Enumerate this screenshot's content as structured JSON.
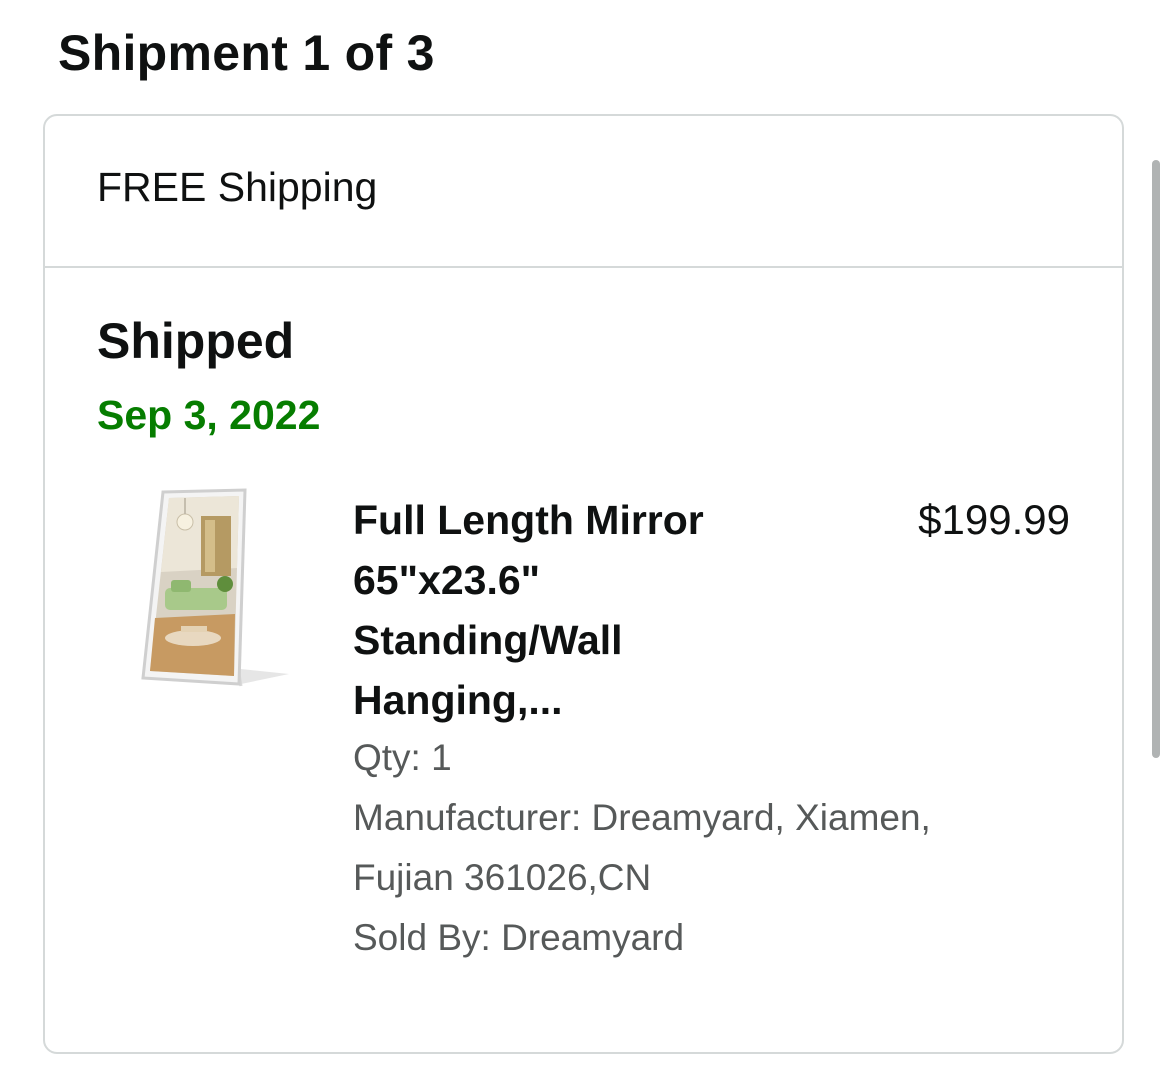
{
  "header": {
    "shipment_title": "Shipment 1 of 3"
  },
  "card": {
    "shipping_label": "FREE Shipping",
    "status": "Shipped",
    "status_date": "Sep 3, 2022",
    "status_date_color": "#067d00"
  },
  "item": {
    "image_icon": "product-mirror-image",
    "title": "Full Length Mirror 65\"x23.6\" Standing/Wall Hanging,...",
    "price": "$199.99",
    "qty": "Qty: 1",
    "manufacturer": "Manufacturer: Dreamyard, Xiamen, Fujian 361026,CN",
    "sold_by": "Sold By: Dreamyard"
  }
}
